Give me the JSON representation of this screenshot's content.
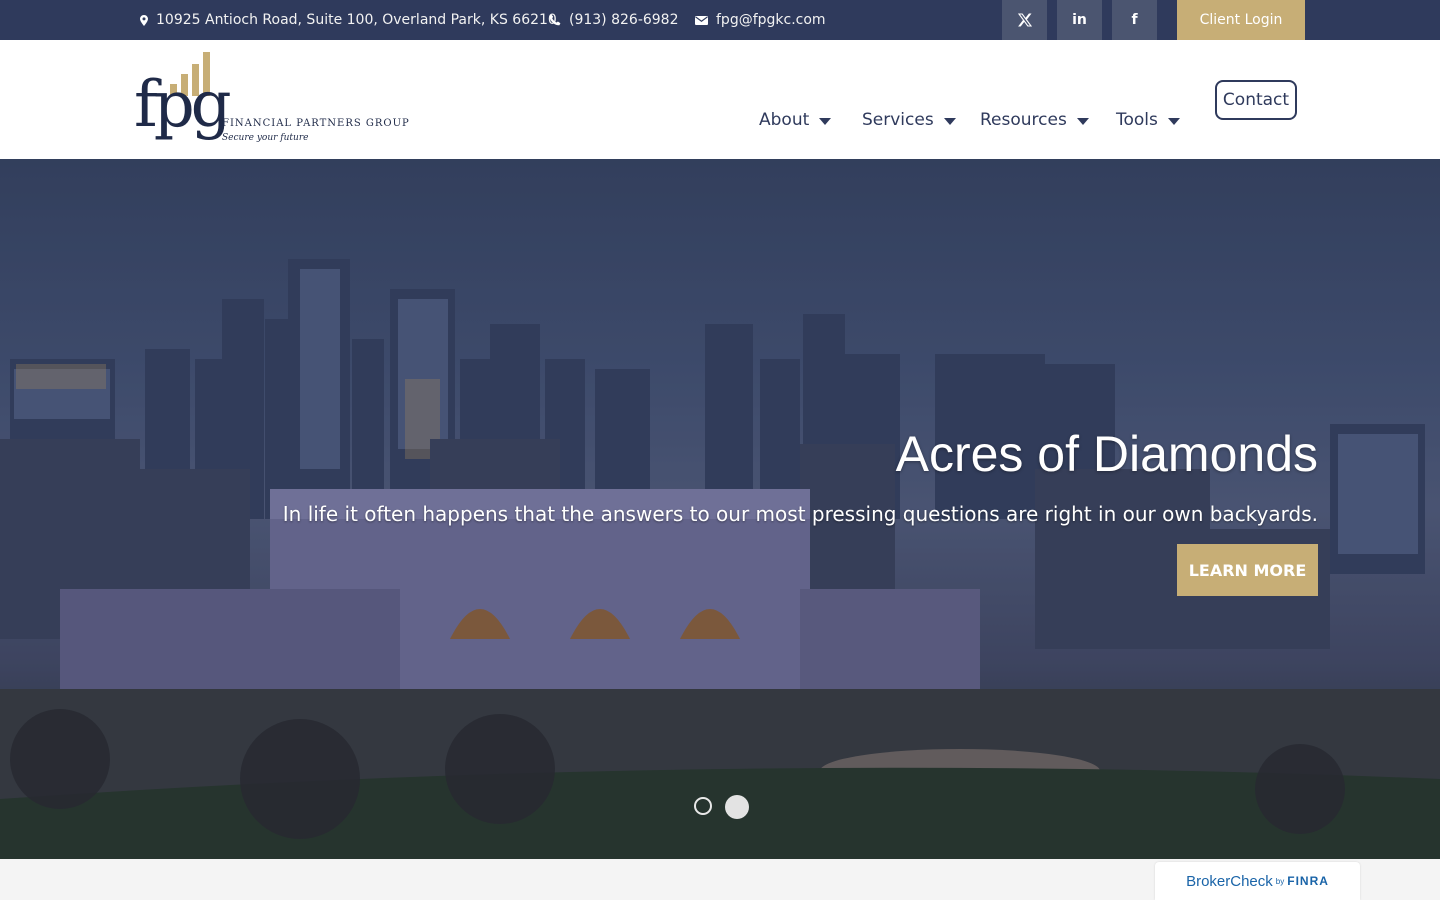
{
  "topbar": {
    "address": "10925 Antioch Road, Suite 100, Overland Park, KS 66210",
    "phone": "(913) 826-6982",
    "email": "fpg@fpgkc.com",
    "social": [
      {
        "name": "x-twitter-icon",
        "glyph": "𝕏"
      },
      {
        "name": "linkedin-icon",
        "glyph": "in"
      },
      {
        "name": "facebook-icon",
        "glyph": "f"
      }
    ],
    "client_login": "Client Login"
  },
  "logo": {
    "mark": "fpg",
    "name": "FINANCIAL PARTNERS GROUP",
    "tagline": "Secure your future"
  },
  "nav": {
    "items": [
      {
        "label": "About"
      },
      {
        "label": "Services"
      },
      {
        "label": "Resources"
      },
      {
        "label": "Tools"
      }
    ],
    "contact": "Contact"
  },
  "hero": {
    "title": "Acres of Diamonds",
    "subtitle": "In life it often happens that the answers to our most pressing questions are right in our own backyards.",
    "cta": "LEARN MORE",
    "slides_total": 2,
    "active_slide": 2
  },
  "brokercheck": {
    "main": "BrokerCheck",
    "by": "by",
    "org": "FINRA"
  },
  "colors": {
    "navy": "#2f3a5c",
    "gold": "#c7ae76",
    "social_bg": "#4b5570"
  }
}
